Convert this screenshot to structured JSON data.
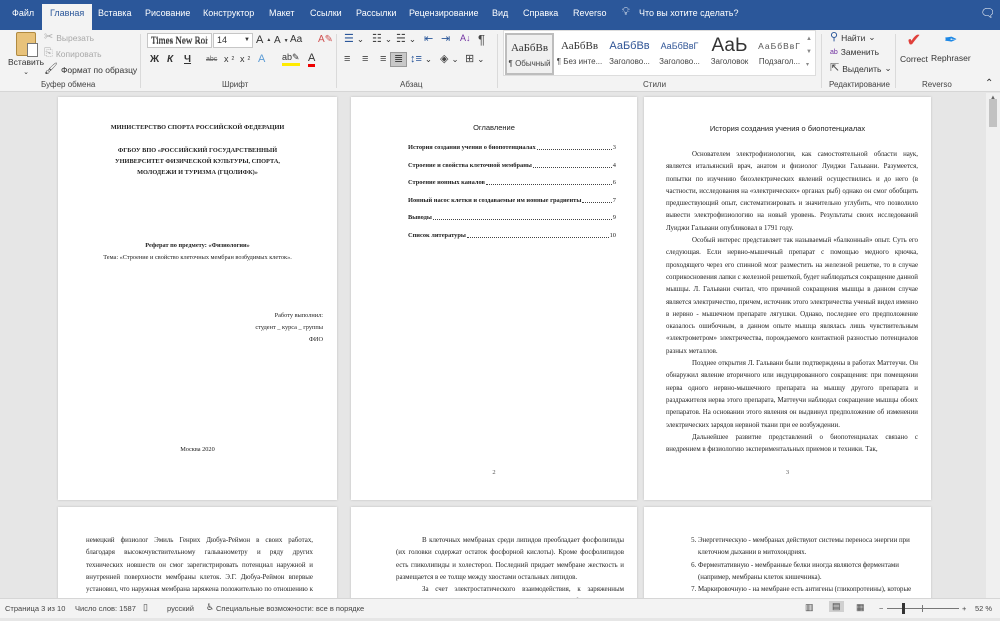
{
  "tabs": [
    "Файл",
    "Главная",
    "Вставка",
    "Рисование",
    "Конструктор",
    "Макет",
    "Ссылки",
    "Рассылки",
    "Рецензирование",
    "Вид",
    "Справка",
    "Reverso"
  ],
  "active_tab": "Главная",
  "tell_me": "Что вы хотите сделать?",
  "clipboard": {
    "paste": "Вставить",
    "cut": "Вырезать",
    "copy": "Копировать",
    "format_painter": "Формат по образцу",
    "label": "Буфер обмена"
  },
  "font": {
    "name": "Times New Roman",
    "name_shown": "Times New Roi",
    "size": "14",
    "label": "Шрифт",
    "bold": "Ж",
    "italic": "К",
    "underline": "Ч",
    "strike": "abc",
    "change_case": "Aa"
  },
  "paragraph": {
    "label": "Абзац"
  },
  "styles": {
    "label": "Стили",
    "items": [
      {
        "sample": "АаБбВв",
        "name": "¶ Обычный"
      },
      {
        "sample": "АаБбВв",
        "name": "¶ Без инте..."
      },
      {
        "sample": "АаБбВв",
        "name": "Заголово..."
      },
      {
        "sample": "АаБбВвГ",
        "name": "Заголово..."
      },
      {
        "sample": "АаЬ",
        "name": "Заголовок"
      },
      {
        "sample": "АаБбВвГ",
        "name": "Подзагол..."
      }
    ]
  },
  "editing": {
    "label": "Редактирование",
    "find": "Найти",
    "replace": "Заменить",
    "select": "Выделить"
  },
  "reverso": {
    "label": "Reverso",
    "correct": "Correct",
    "rephraser": "Rephraser"
  },
  "page1": {
    "ministry": "МИНИСТЕРСТВО СПОРТА РОССИЙСКОЙ ФЕДЕРАЦИИ",
    "univ1": "ФГБОУ ВПО «РОССИЙСКИЙ ГОСУДАРСТВЕННЫЙ",
    "univ2": "УНИВЕРСИТЕТ ФИЗИЧЕСКОЙ КУЛЬТУРЫ, СПОРТА,",
    "univ3": "МОЛОДЕЖИ И ТУРИЗМА (ГЦОЛИФК)»",
    "subject": "Реферат по предмету: «Физиологии»",
    "topic": "Тема: «Строение и свойство клеточных мембран возбудимых клеток».",
    "done_by": "Работу выполнил:",
    "student": "студент _ курса _ группы",
    "fio": "ФИО",
    "city": "Москва 2020"
  },
  "page2": {
    "title": "Оглавление",
    "toc": [
      {
        "t": "История создания учения о биопотенциалах",
        "p": "3"
      },
      {
        "t": "Строение и свойства клеточной мембраны",
        "p": "4"
      },
      {
        "t": "Строение ионных каналов",
        "p": "6"
      },
      {
        "t": "Ионный насос клетки и создаваемые им ионные градиенты",
        "p": "7"
      },
      {
        "t": "Выводы",
        "p": "9"
      },
      {
        "t": "Список литературы",
        "p": "10"
      }
    ],
    "page_number": "2"
  },
  "page3": {
    "title": "История создания учения о биопотенциалах",
    "paragraphs": [
      "Основателем электрофизиологии, как самостоятельной области наук, является итальянский врач, анатом и физиолог Луиджи Гальвани. Разумеется, попытки по изучению биоэлектрических явлений осуществились и до него (в частности, исследования на «электрических» органах рыб) однако он смог обобщить предшествующий опыт, систематизировать и значительно углубить, что позволило вывести электрофизиологию на новый уровень. Результаты своих исследований Луиджи Гальвани опубликовал в 1791 году.",
      "Особый интерес представляет так называемый «балконный» опыт. Суть его следующая. Если нервно-мышечный препарат с помощью медного крючка, проходящего через его спинной мозг разместить на железной решетке, то в случае соприкосновения лапки с железной решеткой, будет наблюдаться сокращение данной мышцы. Л. Гальвани считал, что причиной сокращения мышцы в данном случае является электричество, причем, источник этого электричества ученый видел именно в нервно - мышечном препарате лягушки. Однако, последнее его предположение оказалось ошибочным, в данном опыте мышца являлась лишь чувствительным «электрометром» электричества, порождаемого контактной разностью потенциалов разных металлов.",
      "Позднее открытия Л. Гальвани были подтверждены в работах Маттеучи. Он обнаружил явление вторичного или индуцированного сокращения: при помещении нерва одного нервно-мышечного препарата на мышцу другого препарата и раздражителя нерва этого препарата, Маттеучи наблюдал сокращение мышцы обоих препаратов. На основании этого явления он выдвинул предположение об изменении электрических зарядов нервной ткани при ее возбуждении.",
      "Дальнейшее развитие представлений о биопотенциалах связано с внедрением в физиологию экспериментальных приемов и техники. Так,"
    ],
    "page_number": "3"
  },
  "page4": {
    "text": "немецкий физиолог Эмиль Генрих Дюбуа-Реймон в своих работах, благодаря высокочувствительному гальванометру и ряду других технических новшеств он смог зарегистрировать потенциал наружной и внутренней поверхности мембраны клеток. Э.Г. Дюбуа-Реймон впервые установил, что наружная мембрана заряжена положительно по отношению к внутренней, и при сокращении мышцы эта разность потенциалов изменяется."
  },
  "page5": {
    "p1": "В клеточных мембранах среди липидов преобладает фосфолипиды (их головки содержат остаток фосфорной кислоты). Кроме фосфолипидов есть гликолипиды и холестерол. Последний придает мембране жесткость и размещается в ее толще между хвостами остальных липидов.",
    "p2": "За счет электростатического взаимодействия, к заряженным головкам липидов присоединяются некоторые молекулы белков, которые становятся"
  },
  "page6": {
    "items": [
      "Энергетическую - мембранах действуют системы переноса энергии при клеточном дыхании в митохондриях.",
      "Ферментативную - мембранные белки иногда являются ферментами (например, мембраны клеток кишечника).",
      "Маркировочную - на мембране есть антигены (гликопротеины), которые позволяют опознать клетку."
    ]
  },
  "status": {
    "page": "Страница 3 из 10",
    "words": "Число слов: 1587",
    "language": "русский",
    "accessibility": "Специальные возможности: все в порядке",
    "zoom": "52 %",
    "zoom_percent": 52
  },
  "colors": {
    "brand": "#2b579a",
    "ribbon": "#f3f3f3",
    "canvas": "#e6e6e6"
  }
}
